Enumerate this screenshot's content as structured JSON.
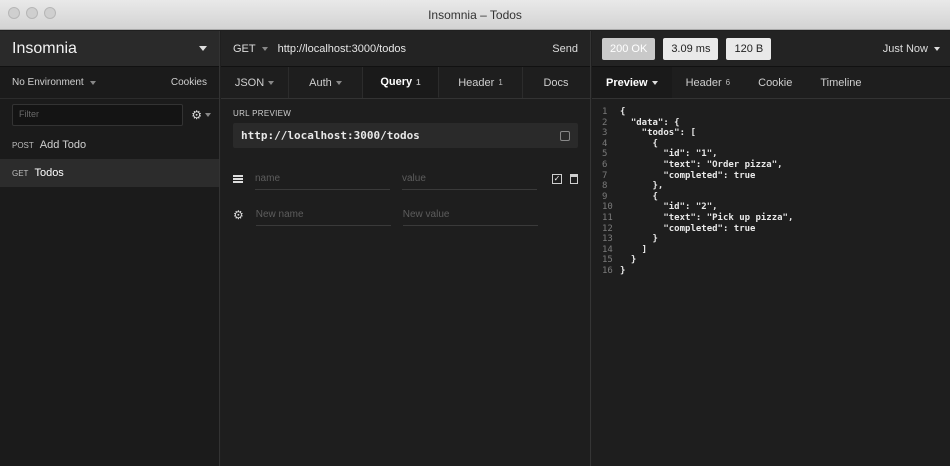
{
  "window": {
    "title": "Insomnia – Todos"
  },
  "sidebar": {
    "app_name": "Insomnia",
    "environment": "No Environment",
    "cookies": "Cookies",
    "filter_placeholder": "Filter",
    "requests": [
      {
        "method": "POST",
        "name": "Add Todo"
      },
      {
        "method": "GET",
        "name": "Todos"
      }
    ]
  },
  "request": {
    "method": "GET",
    "url": "http://localhost:3000/todos",
    "send": "Send",
    "tabs": {
      "body": "JSON",
      "auth": "Auth",
      "query": "Query",
      "query_count": "1",
      "header": "Header",
      "header_count": "1",
      "docs": "Docs"
    },
    "url_preview_label": "URL PREVIEW",
    "url_preview": "http://localhost:3000/todos",
    "params": [
      {
        "name_placeholder": "name",
        "value_placeholder": "value"
      },
      {
        "name_placeholder": "New name",
        "value_placeholder": "New value"
      }
    ]
  },
  "response": {
    "status": "200 OK",
    "time": "3.09 ms",
    "size": "120 B",
    "when": "Just Now",
    "tabs": {
      "preview": "Preview",
      "header": "Header",
      "header_count": "6",
      "cookie": "Cookie",
      "timeline": "Timeline"
    },
    "lines": [
      {
        "n": "1",
        "text": "{"
      },
      {
        "n": "2",
        "text": "  \"data\": {"
      },
      {
        "n": "3",
        "text": "    \"todos\": ["
      },
      {
        "n": "4",
        "text": "      {"
      },
      {
        "n": "5",
        "text": "        \"id\": \"1\","
      },
      {
        "n": "6",
        "text": "        \"text\": \"Order pizza\","
      },
      {
        "n": "7",
        "text": "        \"completed\": true"
      },
      {
        "n": "8",
        "text": "      },"
      },
      {
        "n": "9",
        "text": "      {"
      },
      {
        "n": "10",
        "text": "        \"id\": \"2\","
      },
      {
        "n": "11",
        "text": "        \"text\": \"Pick up pizza\","
      },
      {
        "n": "12",
        "text": "        \"completed\": true"
      },
      {
        "n": "13",
        "text": "      }"
      },
      {
        "n": "14",
        "text": "    ]"
      },
      {
        "n": "15",
        "text": "  }"
      },
      {
        "n": "16",
        "text": "}"
      }
    ]
  }
}
